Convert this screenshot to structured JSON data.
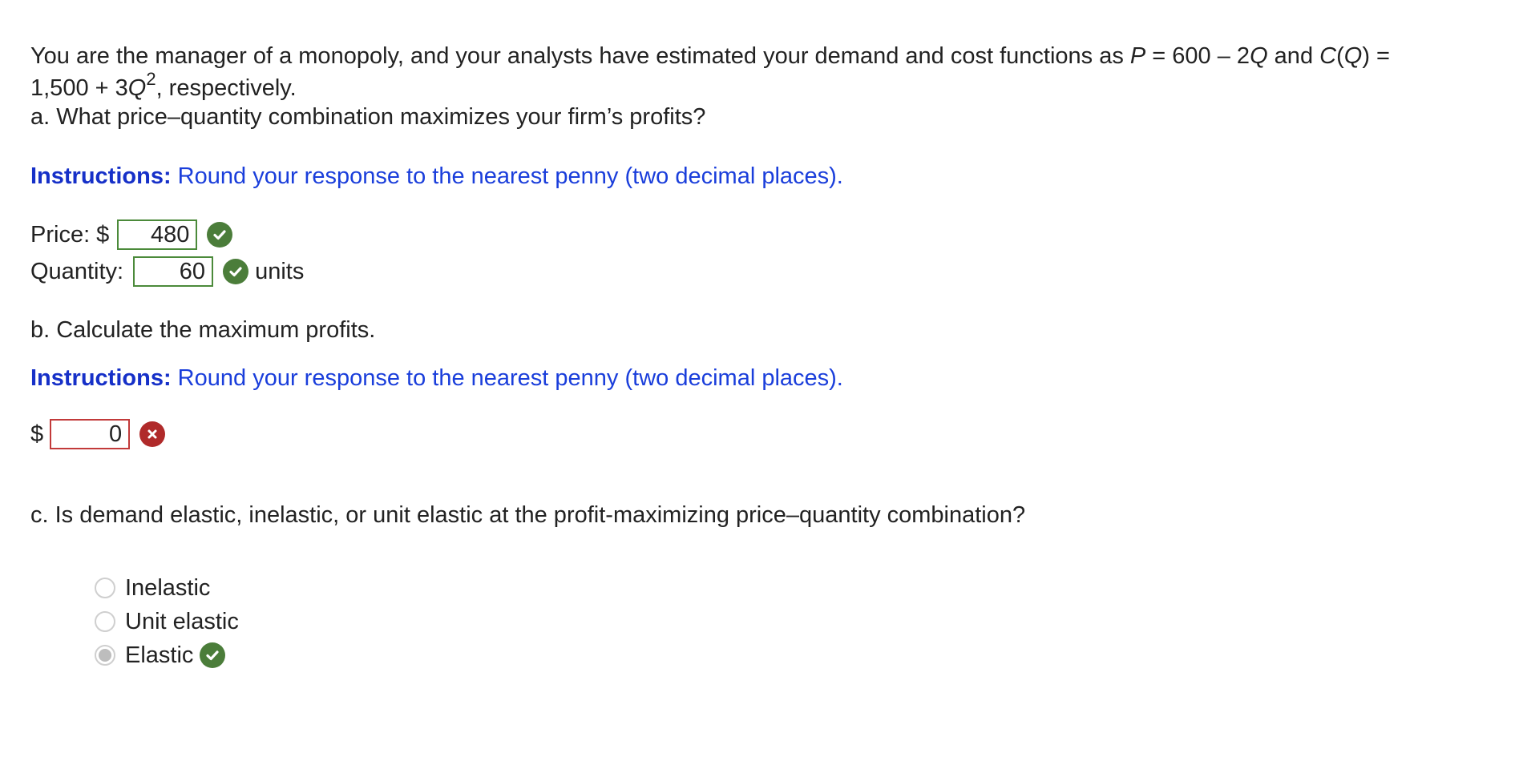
{
  "question": {
    "intro_a": "You are the manager of a monopoly, and your analysts have estimated your demand and cost functions as ",
    "demand_var": "P",
    "demand_mid": " = 600 – 2",
    "demand_q": "Q",
    "demand_and": " and ",
    "cost_c": "C",
    "cost_paren_open": "(",
    "cost_q": "Q",
    "cost_end": ") =",
    "line2_a": "1,500 + 3",
    "line2_q": "Q",
    "line2_exp": "2",
    "line2_end": ", respectively."
  },
  "part_a": {
    "prompt": "a. What price–quantity combination maximizes your firm’s profits?",
    "instructions_label": "Instructions:",
    "instructions_text": " Round your response to the nearest penny (two decimal places).",
    "price_label": "Price: $",
    "price_value": "480",
    "quantity_label": "Quantity:",
    "quantity_value": "60",
    "quantity_unit": "units"
  },
  "part_b": {
    "prompt": "b. Calculate the maximum profits.",
    "instructions_label": "Instructions:",
    "instructions_text": " Round your response to the nearest penny (two decimal places).",
    "currency": "$",
    "profit_value": "0"
  },
  "part_c": {
    "prompt": "c. Is demand elastic, inelastic, or unit elastic at the profit-maximizing price–quantity combination?",
    "options": [
      {
        "label": "Inelastic",
        "selected": false
      },
      {
        "label": "Unit elastic",
        "selected": false
      },
      {
        "label": "Elastic",
        "selected": true
      }
    ]
  },
  "colors": {
    "instructions_blue": "#1a3edb",
    "correct_green": "#4b7d3a",
    "wrong_red": "#b02a2a"
  },
  "icons": [
    "check-icon",
    "x-icon",
    "radio-icon"
  ]
}
